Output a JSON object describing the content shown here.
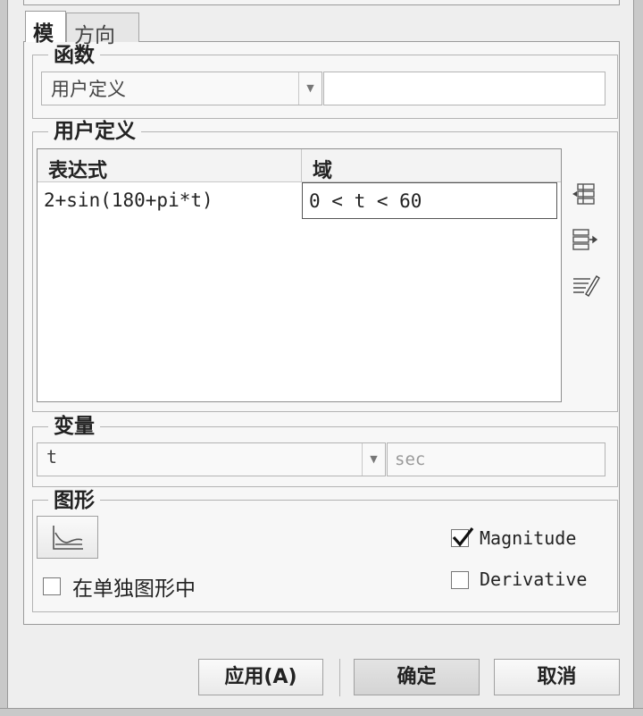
{
  "tabs": [
    {
      "label": "模",
      "active": true
    },
    {
      "label": "方向",
      "active": false
    }
  ],
  "function_group": {
    "title": "函数",
    "selected": "用户定义",
    "value": ""
  },
  "user_defined_group": {
    "title": "用户定义",
    "columns": [
      "表达式",
      "域"
    ],
    "rows": [
      {
        "expression": "2+sin(180+pi*t)",
        "domain": "0 < t < 60"
      }
    ],
    "icons": [
      "insert-row-icon",
      "append-row-icon",
      "edit-expression-icon"
    ]
  },
  "variable_group": {
    "title": "变量",
    "selected": "t",
    "unit_placeholder": "sec"
  },
  "graph_group": {
    "title": "图形",
    "graph_button_icon": "graph-icon",
    "separate_graph_label": "在单独图形中",
    "separate_graph_checked": false,
    "magnitude_label": "Magnitude",
    "magnitude_checked": true,
    "derivative_label": "Derivative",
    "derivative_checked": false
  },
  "buttons": {
    "apply": "应用(A)",
    "ok": "确定",
    "cancel": "取消"
  }
}
